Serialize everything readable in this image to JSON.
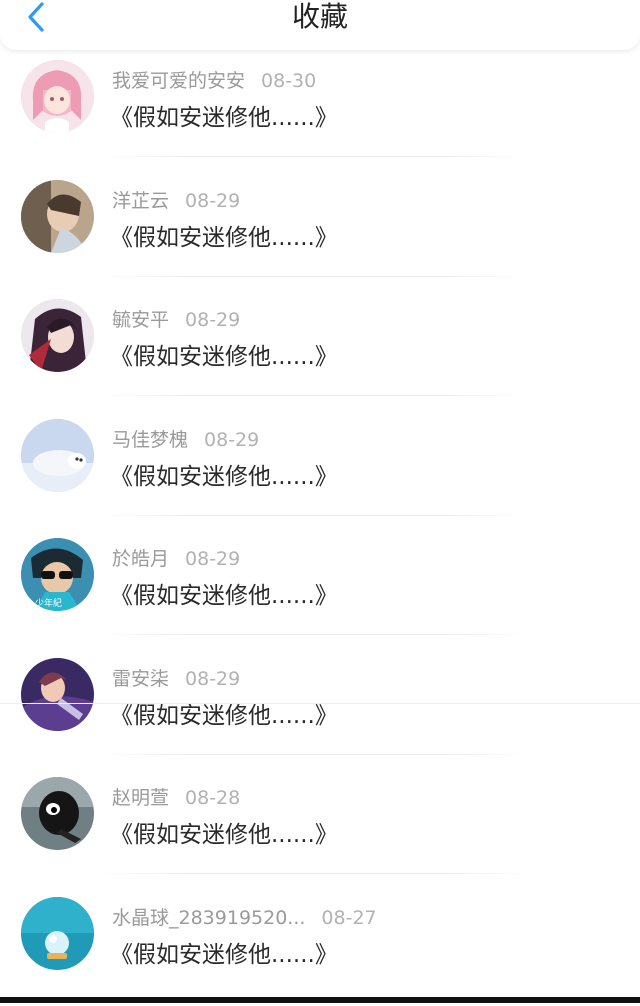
{
  "header": {
    "title": "收藏",
    "back_icon": "chevron-left-icon",
    "accent": "#2b9cf2"
  },
  "items": [
    {
      "name": "我爱可爱的安安",
      "date": "08-30",
      "content": "《假如安迷修他......》",
      "avatar": "anime-girl-pink"
    },
    {
      "name": "洋芷云",
      "date": "08-29",
      "content": "《假如安迷修他......》",
      "avatar": "photo-person"
    },
    {
      "name": "毓安平",
      "date": "08-29",
      "content": "《假如安迷修他......》",
      "avatar": "anime-boy-dark"
    },
    {
      "name": "马佳梦槐",
      "date": "08-29",
      "content": "《假如安迷修他......》",
      "avatar": "seal"
    },
    {
      "name": "於皓月",
      "date": "08-29",
      "content": "《假如安迷修他......》",
      "avatar": "sunglasses-boy",
      "avatar_text": "少年紀"
    },
    {
      "name": "雷安柒",
      "date": "08-29",
      "content": "《假如安迷修他......》",
      "avatar": "anime-purple"
    },
    {
      "name": "赵明萱",
      "date": "08-28",
      "content": "《假如安迷修他......》",
      "avatar": "black-creature"
    },
    {
      "name": "水晶球_283919520...",
      "date": "08-27",
      "content": "《假如安迷修他......》",
      "avatar": "crystal-ball"
    }
  ]
}
